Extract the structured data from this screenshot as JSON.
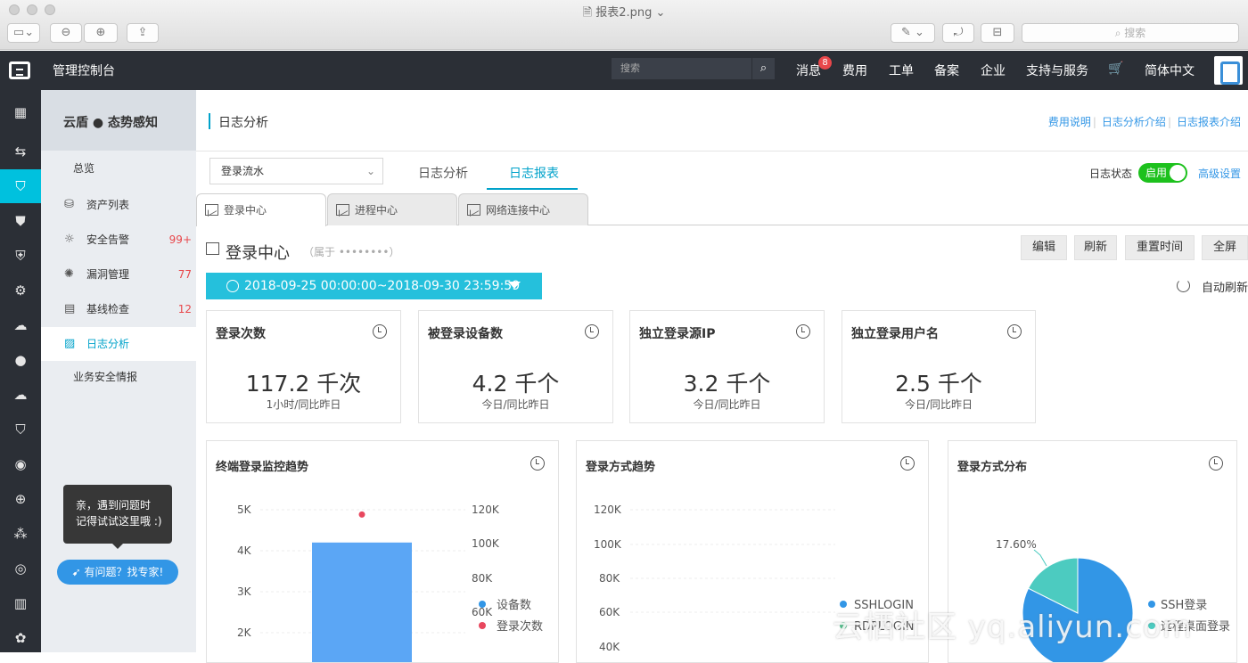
{
  "window": {
    "title": "报表2.png",
    "search_placeholder": "搜索"
  },
  "topnav": {
    "console_title": "管理控制台",
    "search_placeholder": "搜索",
    "messages_label": "消息",
    "messages_badge": "8",
    "items": [
      "费用",
      "工单",
      "备案",
      "企业",
      "支持与服务"
    ],
    "language": "简体中文"
  },
  "sidebar": {
    "product": "云盾 ● 态势感知",
    "items": [
      {
        "label": "总览",
        "count": ""
      },
      {
        "label": "资产列表",
        "count": ""
      },
      {
        "label": "安全告警",
        "count": "99+"
      },
      {
        "label": "漏洞管理",
        "count": "77"
      },
      {
        "label": "基线检查",
        "count": "12"
      },
      {
        "label": "日志分析",
        "count": ""
      },
      {
        "label": "业务安全情报",
        "count": ""
      }
    ],
    "tooltip_line1": "亲，遇到问题时",
    "tooltip_line2": "记得试试这里哦 :)",
    "help_button": "有问题？找专家!"
  },
  "header": {
    "title": "日志分析",
    "links": [
      "费用说明",
      "日志分析介绍",
      "日志报表介绍"
    ]
  },
  "toolbar": {
    "select_value": "登录流水",
    "tabs": [
      "日志分析",
      "日志报表"
    ],
    "active_tab": "日志报表",
    "log_status_label": "日志状态",
    "toggle_label": "启用",
    "advanced_link": "高级设置"
  },
  "subtabs": [
    "登录中心",
    "进程中心",
    "网络连接中心"
  ],
  "section": {
    "title": "登录中心",
    "owner": "（属于 ••••••••）",
    "buttons": [
      "编辑",
      "刷新",
      "重置时间",
      "全屏"
    ],
    "date_range": "2018-09-25 00:00:00~2018-09-30 23:59:59",
    "auto_refresh": "自动刷新"
  },
  "cards": [
    {
      "title": "登录次数",
      "value": "117.2 千次",
      "sub": "1小时/同比昨日"
    },
    {
      "title": "被登录设备数",
      "value": "4.2 千个",
      "sub": "今日/同比昨日"
    },
    {
      "title": "独立登录源IP",
      "value": "3.2 千个",
      "sub": "今日/同比昨日"
    },
    {
      "title": "独立登录用户名",
      "value": "2.5 千个",
      "sub": "今日/同比昨日"
    }
  ],
  "panels": {
    "monitor_title": "终端登录监控趋势",
    "method_trend_title": "登录方式趋势",
    "method_dist_title": "登录方式分布"
  },
  "chart_data": [
    {
      "type": "bar",
      "title": "终端登录监控趋势",
      "left_ticks": [
        "5K",
        "4K",
        "3K",
        "2K"
      ],
      "right_ticks": [
        "120K",
        "100K",
        "80K",
        "60K"
      ],
      "series": [
        {
          "name": "设备数",
          "values": [
            4200
          ],
          "color": "#5ba6f5"
        },
        {
          "name": "登录次数",
          "values": [
            117200
          ],
          "color": "#e8475e"
        }
      ],
      "ylim_left": [
        0,
        5000
      ],
      "ylim_right": [
        0,
        120000
      ]
    },
    {
      "type": "line",
      "title": "登录方式趋势",
      "y_ticks": [
        "120K",
        "100K",
        "80K",
        "60K",
        "40K"
      ],
      "series": [
        {
          "name": "SSHLOGIN",
          "color": "#3296e6"
        },
        {
          "name": "RDPLOGIN",
          "color": "#4cc08a"
        }
      ]
    },
    {
      "type": "pie",
      "title": "登录方式分布",
      "slices": [
        {
          "name": "SSH登录",
          "value": 82.4,
          "color": "#3296e6"
        },
        {
          "name": "远程桌面登录",
          "value": 17.6,
          "color": "#4ccbc0"
        }
      ],
      "label": "17.60%"
    }
  ],
  "watermark": "云栖社区 yq.aliyun.com"
}
